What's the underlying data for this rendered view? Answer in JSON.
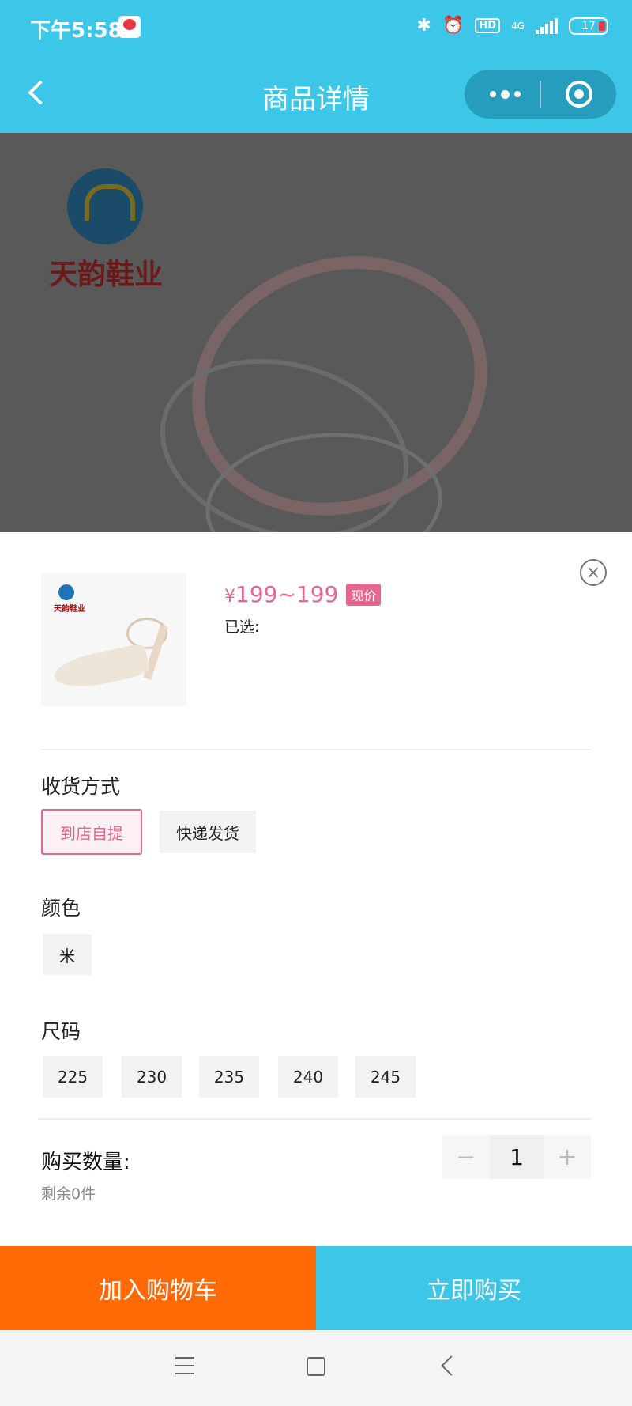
{
  "status_bar": {
    "time": "下午5:58",
    "hd": "HD",
    "network": "4G",
    "battery": "17"
  },
  "nav": {
    "title": "商品详情"
  },
  "backdrop": {
    "brand": "天韵鞋业"
  },
  "product": {
    "thumb_brand": "天韵鞋业",
    "price_currency": "¥",
    "price_range": "199~199",
    "price_tag": "现价",
    "selected_label": "已选:"
  },
  "delivery": {
    "title": "收货方式",
    "options": [
      "到店自提",
      "快递发货"
    ],
    "selected": "到店自提"
  },
  "color": {
    "title": "颜色",
    "options": [
      "米"
    ]
  },
  "size": {
    "title": "尺码",
    "options": [
      "225",
      "230",
      "235",
      "240",
      "245"
    ]
  },
  "quantity": {
    "label": "购买数量:",
    "remaining": "剩余0件",
    "value": "1",
    "minus": "−",
    "plus": "+"
  },
  "actions": {
    "add_to_cart": "加入购物车",
    "buy_now": "立即购买"
  },
  "colors": {
    "header_bg": "#3cc6e8",
    "accent_pink": "#e5678f",
    "cart_orange": "#ff6a07",
    "buy_blue": "#3cc6e8"
  }
}
